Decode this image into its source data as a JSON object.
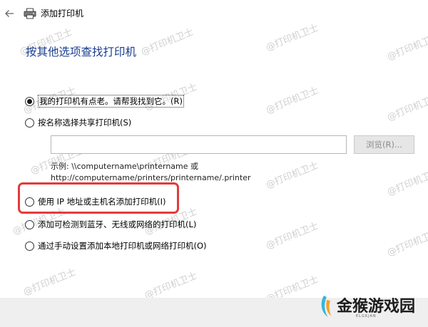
{
  "window": {
    "title": "添加打印机"
  },
  "heading": "按其他选项查找打印机",
  "options": [
    {
      "label": "我的打印机有点老。请帮我找到它。(R)",
      "selected": true
    },
    {
      "label": "按名称选择共享打印机(S)",
      "selected": false
    },
    {
      "label": "使用 IP 地址或主机名添加打印机(I)",
      "selected": false
    },
    {
      "label": "添加可检测到蓝牙、无线或网络的打印机(L)",
      "selected": false
    },
    {
      "label": "通过手动设置添加本地打印机或网络打印机(O)",
      "selected": false
    }
  ],
  "share": {
    "input_value": "",
    "browse_label": "浏览(R)...",
    "example_line1": "示例: \\\\computername\\printername 或",
    "example_line2": "http://computername/printers/printername/.printer"
  },
  "watermark_text": "@打印机卫士",
  "brand": {
    "name": "金猴游戏园",
    "sub": "ELGKJAN"
  },
  "colors": {
    "heading": "#1a3d8f",
    "highlight": "#e53a3a",
    "footer": "#efefef"
  },
  "icons": {
    "back": "back-arrow-icon",
    "printer": "printer-icon",
    "brand": "brand-logo-icon"
  }
}
